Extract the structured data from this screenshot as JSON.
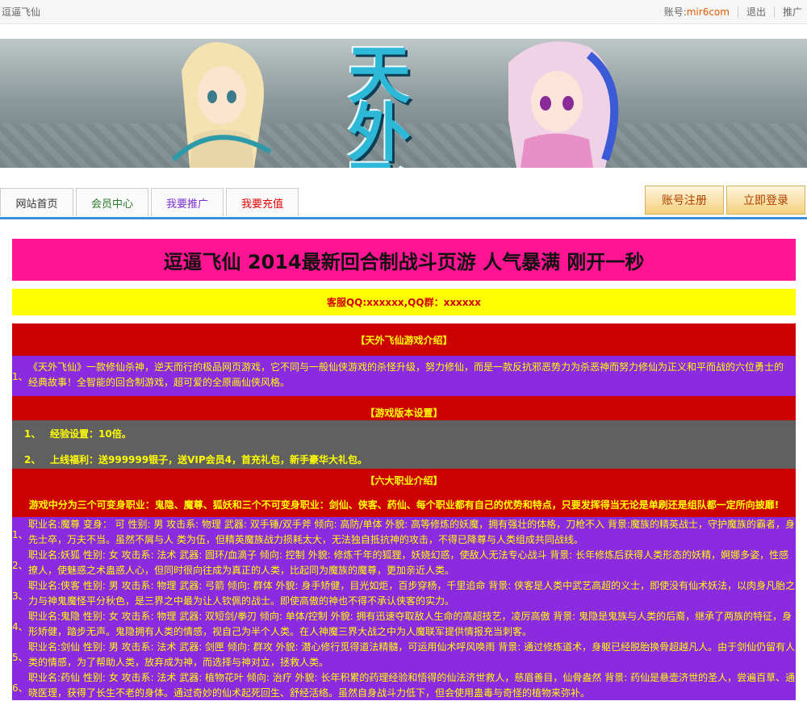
{
  "topbar": {
    "site_name": "逗逼飞仙",
    "account_label": "账号:",
    "account_value": "mir6com",
    "logout": "退出",
    "promote": "推广"
  },
  "banner": {
    "title_art": "天外飞"
  },
  "nav": {
    "tabs": [
      {
        "label": "网站首页",
        "color": "#333333"
      },
      {
        "label": "会员中心",
        "color": "#2a7a2a"
      },
      {
        "label": "我要推广",
        "color": "#7b2fd0"
      },
      {
        "label": "我要充值",
        "color": "#e60000"
      }
    ],
    "register": "账号注册",
    "login": "立即登录"
  },
  "headline": "逗逼飞仙 2014最新回合制战斗页游 人气暴满 刚开一秒",
  "qq": "客服QQ:xxxxxx,QQ群：xxxxxx",
  "sections": {
    "intro_title": "【天外飞仙游戏介绍】",
    "intro": {
      "num": "1、",
      "text": "《天外飞仙》一款修仙杀神，逆天而行的极品网页游戏，它不同与一般仙侠游戏的杀怪升级，努力修仙，而是一款反抗邪恶势力为杀恶神而努力修仙为正义和平而战的六位勇士的经典故事！全智能的回合制游戏，超可爱的全原画仙侠风格。"
    },
    "version_title": "【游戏版本设置】",
    "version_items": [
      {
        "num": "1、",
        "text": "经验设置：10倍。"
      },
      {
        "num": "2、",
        "text": "上线福利：送999999银子，送VIP会员4，首充礼包，新手豪华大礼包。"
      }
    ],
    "class_title": "【六大职业介绍】",
    "class_sub": "游戏中分为三个可变身职业：鬼隐、魔尊、狐妖和三个不可变身职业：剑仙、侠客、药仙、每个职业都有自己的优势和特点，只要发挥得当无论是单刷还是组队都一定所向披靡!",
    "classes": [
      {
        "num": "1、",
        "text": "职业名:魔尊 变身： 可 性别: 男 攻击系: 物理 武器: 双手锤/双手斧 倾向: 高防/单体 外貌: 高等修炼的妖魔，拥有强壮的体格，刀枪不入 背景:魔族的精英战士，守护魔族的霸者，身先士卒，万夫不当。虽然不屑与人 类为伍，但精英魔族战力损耗太大，无法独自抵抗神的攻击，不得已降尊与人类组成共同战线。"
      },
      {
        "num": "2、",
        "text": "职业名:妖狐 性别: 女 攻击系: 法术 武器: 圆环/血滴子 倾向: 控制 外貌: 修炼千年的狐狸，妖娆幻惑，使敌人无法专心战斗 背景: 长年修炼后获得人类形态的妖精，婀娜多姿，性感撩人，使魅惑之术蛊惑人心，但同时很向往成为真正的人类，比起同为魔族的魔尊，更加亲近人类。"
      },
      {
        "num": "3、",
        "text": "职业名:侠客 性别: 男 攻击系: 物理 武器: 弓箭 倾向: 群体 外貌: 身手矫健，目光如炬，百步穿杨，千里追命 背景: 侠客是人类中武艺高超的义士，即使没有仙术妖法，以肉身凡胎之力与神鬼魔怪平分秋色，是三界之中最为让人钦佩的战士。即使高傲的神也不得不承认侠客的实力。"
      },
      {
        "num": "4、",
        "text": "职业名:鬼隐 性别: 女 攻击系: 物理 武器: 双短剑/拳刃 倾向: 单体/控制 外貌: 拥有迅速夺取敌人生命的高超技艺，凌厉高傲 背景: 鬼隐是鬼族与人类的后裔，继承了两族的特征，身形矫健，踏步无声。鬼隐拥有人类的情感，视自己为半个人类。在人神魔三界大战之中为人魔联军提供情报充当刺客。"
      },
      {
        "num": "5、",
        "text": "职业名:剑仙 性别: 男 攻击系: 法术 武器: 剑匣 倾向: 群攻 外貌: 潜心修行觅得道法精髓，可运用仙术呼风唤雨 背景: 通过修炼道术，身躯已经脱胎换骨超越凡人。由于剑仙仍留有人类的情感，为了帮助人类，放弃成为神，而选择与神对立，拯救人类。"
      },
      {
        "num": "6、",
        "text": "职业名:药仙 性别: 女 攻击系: 法术 武器: 植物花叶 倾向: 治疗 外貌: 长年积累的药理经验和悟得的仙法济世救人，慈眉善目，仙骨盎然 背景: 药仙是悬壶济世的圣人，尝遍百草、通晓医理，获得了长生不老的身体。通过奇妙的仙术起死回生、舒经活络。虽然自身战斗力低下，但会使用蛊毒与奇怪的植物来弥补。"
      }
    ]
  }
}
